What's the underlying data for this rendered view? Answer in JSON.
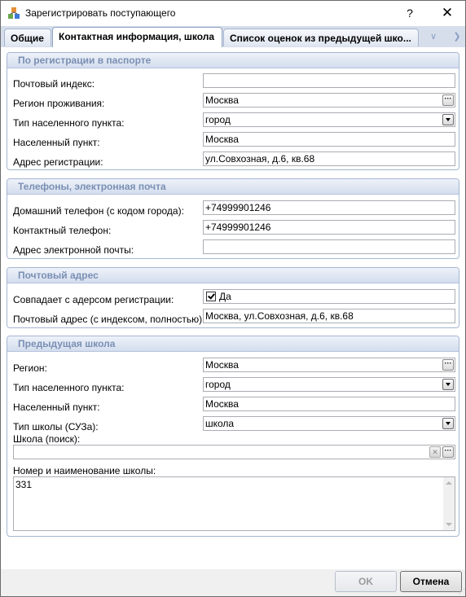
{
  "window": {
    "title": "Зарегистрировать поступающего",
    "help_label": "?",
    "close_label": "✕"
  },
  "tabs": [
    {
      "label": "Общие",
      "active": false
    },
    {
      "label": "Контактная информация, школа",
      "active": true
    },
    {
      "label": "Список оценок из предыдущей шко...",
      "active": false
    }
  ],
  "passport": {
    "header": "По регистрации в паспорте",
    "postcode_label": "Почтовый индекс:",
    "postcode_value": "",
    "region_label": "Регион проживания:",
    "region_value": "Москва",
    "locality_type_label": "Тип населенного пункта:",
    "locality_type_value": "город",
    "locality_label": "Населенный пункт:",
    "locality_value": "Москва",
    "address_label": "Адрес регистрации:",
    "address_value": "ул.Совхозная, д.6, кв.68"
  },
  "phones": {
    "header": "Телефоны, электронная почта",
    "home_label": "Домашний телефон (с кодом города):",
    "home_value": "+74999901246",
    "contact_label": "Контактный телефон:",
    "contact_value": "+74999901246",
    "email_label": "Адрес электронной почты:",
    "email_value": ""
  },
  "postal": {
    "header": "Почтовый адрес",
    "same_label": "Совпадает с адерсом регистрации:",
    "same_checked": true,
    "same_text": "Да",
    "address_label": "Почтовый адрес (с индексом, полностью):",
    "address_value": "Москва, ул.Совхозная, д.6, кв.68"
  },
  "school": {
    "header": "Предыдущая школа",
    "region_label": "Регион:",
    "region_value": "Москва",
    "locality_type_label": "Тип населенного пункта:",
    "locality_type_value": "город",
    "locality_label": "Населенный пункт:",
    "locality_value": "Москва",
    "school_type_label": "Тип школы (СУЗа):",
    "school_type_value": "школа",
    "search_label": "Школа (поиск):",
    "search_value": "",
    "name_label": "Номер и наименование школы:",
    "name_value": "331"
  },
  "buttons": {
    "ok": "OK",
    "cancel": "Отмена"
  }
}
